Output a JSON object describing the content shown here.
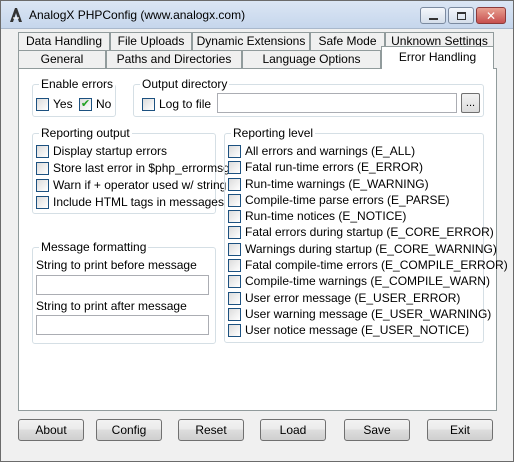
{
  "window": {
    "title": "AnalogX PHPConfig (www.analogx.com)",
    "close_glyph": "✕",
    "icons": {
      "app": "analogx-logo-icon",
      "minimize": "minimize-icon",
      "maximize": "maximize-icon",
      "close": "close-icon"
    }
  },
  "tabs": {
    "row1": [
      "Data Handling",
      "File Uploads",
      "Dynamic Extensions",
      "Safe Mode",
      "Unknown Settings"
    ],
    "row2": [
      "General",
      "Paths and Directories",
      "Language Options",
      "Error Handling"
    ],
    "selected": "Error Handling"
  },
  "enable_errors": {
    "title": "Enable errors",
    "yes": {
      "label": "Yes",
      "checked": false
    },
    "no": {
      "label": "No",
      "checked": true
    }
  },
  "output_directory": {
    "title": "Output directory",
    "log_to_file": {
      "label": "Log to file",
      "checked": false
    },
    "path_value": "",
    "browse_label": "..."
  },
  "reporting_output": {
    "title": "Reporting output",
    "items": [
      {
        "label": "Display startup errors",
        "checked": false
      },
      {
        "label": "Store last error in $php_errormsg",
        "checked": false
      },
      {
        "label": "Warn if + operator used w/ string",
        "checked": false
      },
      {
        "label": "Include HTML tags in messages",
        "checked": false
      }
    ]
  },
  "reporting_level": {
    "title": "Reporting level",
    "items": [
      {
        "label": "All errors and warnings (E_ALL)",
        "checked": false
      },
      {
        "label": "Fatal run-time errors (E_ERROR)",
        "checked": false
      },
      {
        "label": "Run-time warnings (E_WARNING)",
        "checked": false
      },
      {
        "label": "Compile-time parse errors (E_PARSE)",
        "checked": false
      },
      {
        "label": "Run-time notices (E_NOTICE)",
        "checked": false
      },
      {
        "label": "Fatal errors during startup (E_CORE_ERROR)",
        "checked": false
      },
      {
        "label": "Warnings during startup (E_CORE_WARNING)",
        "checked": false
      },
      {
        "label": "Fatal compile-time errors (E_COMPILE_ERROR)",
        "checked": false
      },
      {
        "label": "Compile-time warnings (E_COMPILE_WARN)",
        "checked": false
      },
      {
        "label": "User error message (E_USER_ERROR)",
        "checked": false
      },
      {
        "label": "User warning message (E_USER_WARNING)",
        "checked": false
      },
      {
        "label": "User notice message (E_USER_NOTICE)",
        "checked": false
      }
    ]
  },
  "message_formatting": {
    "title": "Message formatting",
    "before_label": "String to print before message",
    "before_value": "",
    "after_label": "String to print after message",
    "after_value": ""
  },
  "buttons": {
    "about": "About",
    "config": "Config",
    "reset": "Reset",
    "load": "Load",
    "save": "Save",
    "exit": "Exit"
  },
  "colors": {
    "check": "#21a121",
    "tab_border": "#919b9c",
    "group_border": "#d5dfe5",
    "panel_bg": "#ffffff",
    "window_bg": "#f0f0f0"
  }
}
